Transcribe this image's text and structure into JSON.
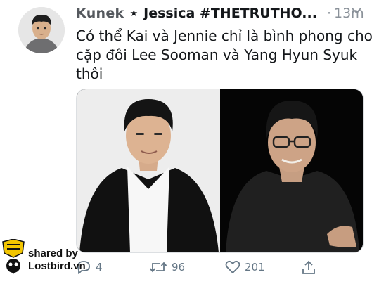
{
  "tweet": {
    "display_name": "Kunek",
    "separator_icon": "star-icon",
    "handle": "Jessica #THETRUTHO...",
    "dot": "·",
    "time": "13m",
    "text": "Có thể Kai và Jennie chỉ là bình phong cho cặp đôi Lee Sooman và Yang Hyun Syuk thôi"
  },
  "actions": {
    "reply_count": "4",
    "retweet_count": "96",
    "like_count": "201"
  },
  "watermark": {
    "line1": "shared by",
    "line2": "Lostbird.vn"
  },
  "colors": {
    "text": "#14171a",
    "muted": "#657786",
    "watermark_yellow": "#f2c500"
  }
}
